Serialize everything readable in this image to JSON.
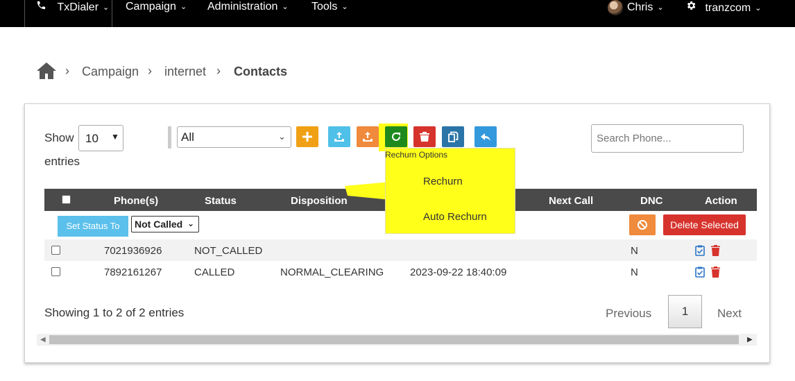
{
  "topbar": {
    "brand": "TxDialer",
    "menu": [
      {
        "label": "Campaign"
      },
      {
        "label": "Administration"
      },
      {
        "label": "Tools"
      }
    ],
    "user": "Chris",
    "account": "tranzcom"
  },
  "breadcrumb": {
    "items": [
      "Campaign",
      "internet",
      "Contacts"
    ]
  },
  "toolbar": {
    "show_label": "Show",
    "page_size": "10",
    "entries_label": "entries",
    "filter_value": "All",
    "search_placeholder": "Search Phone...",
    "recharge_tooltip": "Rechurn Options",
    "colors": {
      "add": "#f0a014",
      "import": "#4fc0e8",
      "export": "#f08a3c",
      "rechurn": "#1e8a1e",
      "delete": "#d7332d",
      "copy": "#2a74a8",
      "back": "#3399dd"
    }
  },
  "dropdown": {
    "items": [
      "Rechurn",
      "Auto Rechurn"
    ]
  },
  "table": {
    "headers": [
      "Phone(s)",
      "Status",
      "Disposition",
      "Next Call",
      "DNC",
      "Action"
    ],
    "set_status_label": "Set Status To",
    "status_select": "Not Called",
    "delete_selected_label": "Delete Selected",
    "rows": [
      {
        "phone": "7021936926",
        "status": "NOT_CALLED",
        "disposition": "",
        "next_call": "",
        "dnc": "N"
      },
      {
        "phone": "7892161267",
        "status": "CALLED",
        "disposition": "NORMAL_CLEARING",
        "next_call": "2023-09-22 18:40:09",
        "dnc": "N"
      }
    ]
  },
  "footer": {
    "info": "Showing 1 to 2 of 2 entries",
    "previous": "Previous",
    "page": "1",
    "next": "Next"
  }
}
